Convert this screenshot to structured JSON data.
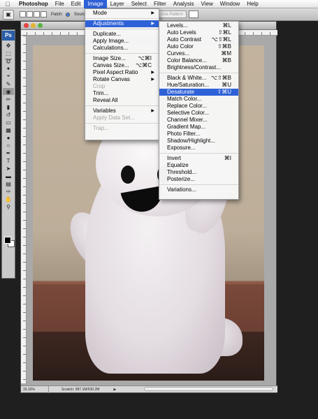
{
  "menubar": {
    "apple": "",
    "app": "Photoshop",
    "items": [
      "File",
      "Edit",
      "Image",
      "Layer",
      "Select",
      "Filter",
      "Analysis",
      "View",
      "Window",
      "Help"
    ],
    "active": "Image"
  },
  "options": {
    "patch_label": "Patch:",
    "source_label": "Source",
    "pattern_label": "Use Pattern"
  },
  "toolbox": {
    "logo": "Ps",
    "tools": [
      "move-icon",
      "marquee-icon",
      "lasso-icon",
      "magic-wand-icon",
      "crop-icon",
      "slice-icon",
      "patch-icon",
      "brush-icon",
      "clone-stamp-icon",
      "history-brush-icon",
      "eraser-icon",
      "gradient-icon",
      "blur-icon",
      "dodge-icon",
      "pen-icon",
      "type-icon",
      "path-select-icon",
      "shape-icon",
      "notes-icon",
      "eyedropper-icon",
      "hand-icon",
      "zoom-icon"
    ],
    "fg_color": "#000000",
    "bg_color": "#ffffff"
  },
  "document": {
    "zoom": "33.33%",
    "scratch": "Scratch: 587.1M/530.2M"
  },
  "image_menu": {
    "items": [
      {
        "label": "Mode",
        "submenu": true
      },
      {
        "sep": true
      },
      {
        "label": "Adjustments",
        "submenu": true,
        "highlight": true
      },
      {
        "sep": true
      },
      {
        "label": "Duplicate..."
      },
      {
        "label": "Apply Image..."
      },
      {
        "label": "Calculations..."
      },
      {
        "sep": true
      },
      {
        "label": "Image Size...",
        "shortcut": "⌥⌘I"
      },
      {
        "label": "Canvas Size...",
        "shortcut": "⌥⌘C"
      },
      {
        "label": "Pixel Aspect Ratio",
        "submenu": true
      },
      {
        "label": "Rotate Canvas",
        "submenu": true
      },
      {
        "label": "Crop",
        "disabled": true
      },
      {
        "label": "Trim..."
      },
      {
        "label": "Reveal All"
      },
      {
        "sep": true
      },
      {
        "label": "Variables",
        "submenu": true
      },
      {
        "label": "Apply Data Set...",
        "disabled": true
      },
      {
        "sep": true
      },
      {
        "label": "Trap...",
        "disabled": true
      }
    ]
  },
  "adjustments_menu": {
    "items": [
      {
        "label": "Levels...",
        "shortcut": "⌘L"
      },
      {
        "label": "Auto Levels",
        "shortcut": "⇧⌘L"
      },
      {
        "label": "Auto Contrast",
        "shortcut": "⌥⇧⌘L"
      },
      {
        "label": "Auto Color",
        "shortcut": "⇧⌘B"
      },
      {
        "label": "Curves...",
        "shortcut": "⌘M"
      },
      {
        "label": "Color Balance...",
        "shortcut": "⌘B"
      },
      {
        "label": "Brightness/Contrast..."
      },
      {
        "sep": true
      },
      {
        "label": "Black & White...",
        "shortcut": "⌥⇧⌘B"
      },
      {
        "label": "Hue/Saturation...",
        "shortcut": "⌘U"
      },
      {
        "label": "Desaturate",
        "shortcut": "⇧⌘U",
        "highlight": true
      },
      {
        "label": "Match Color..."
      },
      {
        "label": "Replace Color..."
      },
      {
        "label": "Selective Color..."
      },
      {
        "label": "Channel Mixer..."
      },
      {
        "label": "Gradient Map..."
      },
      {
        "label": "Photo Filter..."
      },
      {
        "label": "Shadow/Highlight..."
      },
      {
        "label": "Exposure..."
      },
      {
        "sep": true
      },
      {
        "label": "Invert",
        "shortcut": "⌘I"
      },
      {
        "label": "Equalize"
      },
      {
        "label": "Threshold..."
      },
      {
        "label": "Posterize..."
      },
      {
        "sep": true
      },
      {
        "label": "Variations..."
      }
    ]
  },
  "colors": {
    "highlight": "#2f62d7",
    "menubar_active": "#2e5fd6"
  }
}
